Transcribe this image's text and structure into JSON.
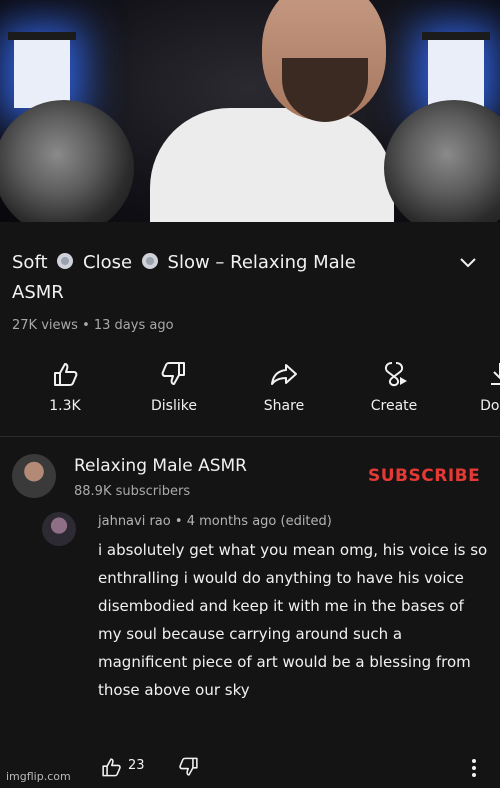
{
  "video": {
    "title_parts": [
      "Soft",
      "Close",
      "Slow – Relaxing Male",
      "ASMR"
    ],
    "views": "27K views",
    "age": "13 days ago",
    "meta_sep": "•"
  },
  "actions": [
    {
      "label": "1.3K",
      "icon": "thumbs-up-icon"
    },
    {
      "label": "Dislike",
      "icon": "thumbs-down-icon"
    },
    {
      "label": "Share",
      "icon": "share-icon"
    },
    {
      "label": "Create",
      "icon": "create-icon"
    },
    {
      "label": "Down",
      "icon": "download-icon"
    }
  ],
  "channel": {
    "name": "Relaxing Male ASMR",
    "subscribers": "88.9K subscribers",
    "subscribe_label": "SUBSCRIBE"
  },
  "comment": {
    "author": "jahnavi rao",
    "sep": "•",
    "age": "4 months ago (edited)",
    "text": "i absolutely get what you mean omg, his voice is so enthralling i would do anything to have his voice disembodied and keep it with me in the bases of my soul because carrying around such a magnificent piece of art would be a blessing from those above our sky",
    "likes": "23"
  },
  "watermark": "imgflip.com",
  "colors": {
    "background": "#141414",
    "subscribe": "#e53935",
    "secondary_text": "#a9a9a9"
  }
}
